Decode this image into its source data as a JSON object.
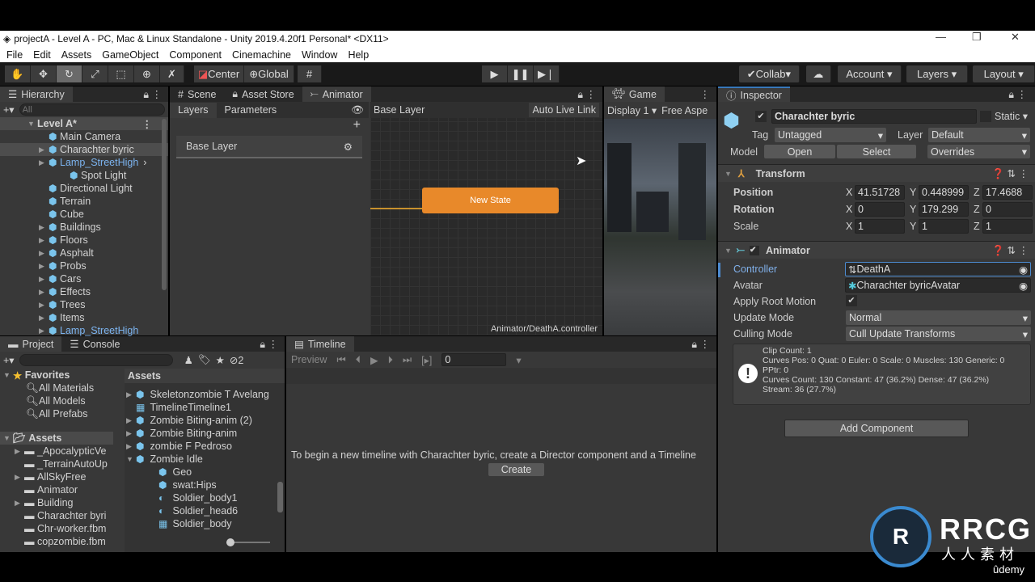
{
  "window": {
    "title": "projectA - Level A - PC, Mac & Linux Standalone - Unity 2019.4.20f1 Personal* <DX11>"
  },
  "menu": [
    "File",
    "Edit",
    "Assets",
    "GameObject",
    "Component",
    "Cinemachine",
    "Window",
    "Help"
  ],
  "toolbar": {
    "center": "Center",
    "global": "Global",
    "collab": "Collab",
    "account": "Account",
    "layers": "Layers",
    "layout": "Layout"
  },
  "hierarchy": {
    "title": "Hierarchy",
    "search_placeholder": "All",
    "scene": "Level A*",
    "items": [
      {
        "label": "Main Camera",
        "arrow": false
      },
      {
        "label": "Charachter byric",
        "arrow": true,
        "selected": true
      },
      {
        "label": "Lamp_StreetHigh",
        "arrow": true,
        "prefab": true
      },
      {
        "label": "Spot Light",
        "arrow": false,
        "child": true
      },
      {
        "label": "Directional Light"
      },
      {
        "label": "Terrain"
      },
      {
        "label": "Cube"
      },
      {
        "label": "Buildings",
        "arrow": true
      },
      {
        "label": "Floors",
        "arrow": true
      },
      {
        "label": "Asphalt",
        "arrow": true
      },
      {
        "label": "Probs",
        "arrow": true
      },
      {
        "label": "Cars",
        "arrow": true
      },
      {
        "label": "Effects",
        "arrow": true
      },
      {
        "label": "Trees",
        "arrow": true
      },
      {
        "label": "Items",
        "arrow": true
      },
      {
        "label": "Lamp_StreetHigh",
        "arrow": true,
        "prefab": true
      }
    ]
  },
  "center_tabs": [
    "Scene",
    "Asset Store",
    "Animator"
  ],
  "animator": {
    "layers_tab": "Layers",
    "parameters_tab": "Parameters",
    "layer_name": "Base Layer",
    "breadcrumb": "Base Layer",
    "auto_live_link": "Auto Live Link",
    "state": "New State",
    "footer": "Animator/DeathA.controller",
    "state_color": "#e8892a"
  },
  "game": {
    "title": "Game",
    "display": "Display 1",
    "aspect": "Free Aspe"
  },
  "inspector": {
    "title": "Inspector",
    "object_name": "Charachter byric",
    "static": "Static",
    "tag_label": "Tag",
    "tag": "Untagged",
    "layer_label": "Layer",
    "layer": "Default",
    "model_label": "Model",
    "open": "Open",
    "select": "Select",
    "overrides": "Overrides",
    "transform": {
      "title": "Transform",
      "rows": [
        {
          "label": "Position",
          "x": "41.51728",
          "y": "0.448999",
          "z": "17.4688"
        },
        {
          "label": "Rotation",
          "x": "0",
          "y": "179.299",
          "z": "0"
        },
        {
          "label": "Scale",
          "x": "1",
          "y": "1",
          "z": "1"
        }
      ]
    },
    "animator": {
      "title": "Animator",
      "controller_label": "Controller",
      "controller": "DeathA",
      "avatar_label": "Avatar",
      "avatar": "Charachter byricAvatar",
      "root_motion_label": "Apply Root Motion",
      "update_label": "Update Mode",
      "update": "Normal",
      "culling_label": "Culling Mode",
      "culling": "Cull Update Transforms",
      "info": [
        "Clip Count: 1",
        "Curves Pos: 0 Quat: 0 Euler: 0 Scale: 0 Muscles: 130 Generic: 0",
        "PPtr: 0",
        "Curves Count: 130 Constant: 47 (36.2%) Dense: 47 (36.2%)",
        "Stream: 36 (27.7%)"
      ]
    },
    "add_component": "Add Component"
  },
  "project": {
    "tabs": [
      "Project",
      "Console"
    ],
    "hidden_count": "2",
    "favorites": "Favorites",
    "fav_items": [
      "All Materials",
      "All Models",
      "All Prefabs"
    ],
    "assets": "Assets",
    "folders": [
      {
        "label": "_ApocalypticVe",
        "arrow": true
      },
      {
        "label": "_TerrainAutoUp"
      },
      {
        "label": "AllSkyFree",
        "arrow": true
      },
      {
        "label": "Animator"
      },
      {
        "label": "Building",
        "arrow": true
      },
      {
        "label": "Charachter byri"
      },
      {
        "label": "Chr-worker.fbm"
      },
      {
        "label": "copzombie.fbm"
      }
    ],
    "files_header": "Assets",
    "files": [
      {
        "label": "Skeletonzombie T Avelang",
        "icon": "model",
        "arrow": "right"
      },
      {
        "label": "TimelineTimeline1",
        "icon": "timeline"
      },
      {
        "label": "Zombie Biting-anim (2)",
        "icon": "model",
        "arrow": "right"
      },
      {
        "label": "Zombie Biting-anim",
        "icon": "model",
        "arrow": "right"
      },
      {
        "label": "zombie F Pedroso",
        "icon": "model",
        "arrow": "right"
      },
      {
        "label": "Zombie Idle",
        "icon": "model",
        "arrow": "down"
      },
      {
        "label": "Geo",
        "icon": "model",
        "child": true
      },
      {
        "label": "swat:Hips",
        "icon": "model",
        "child": true
      },
      {
        "label": "Soldier_body1",
        "icon": "material",
        "child": true
      },
      {
        "label": "Soldier_head6",
        "icon": "material",
        "child": true
      },
      {
        "label": "Soldier_body",
        "icon": "mesh",
        "child": true
      }
    ]
  },
  "timeline": {
    "title": "Timeline",
    "preview": "Preview",
    "frame": "0",
    "message": "To begin a new timeline with Charachter byric, create a Director component and a Timeline",
    "create": "Create"
  },
  "watermark": {
    "brand": "RRCG",
    "sub": "人人素材",
    "udemy": "ûdemy"
  }
}
